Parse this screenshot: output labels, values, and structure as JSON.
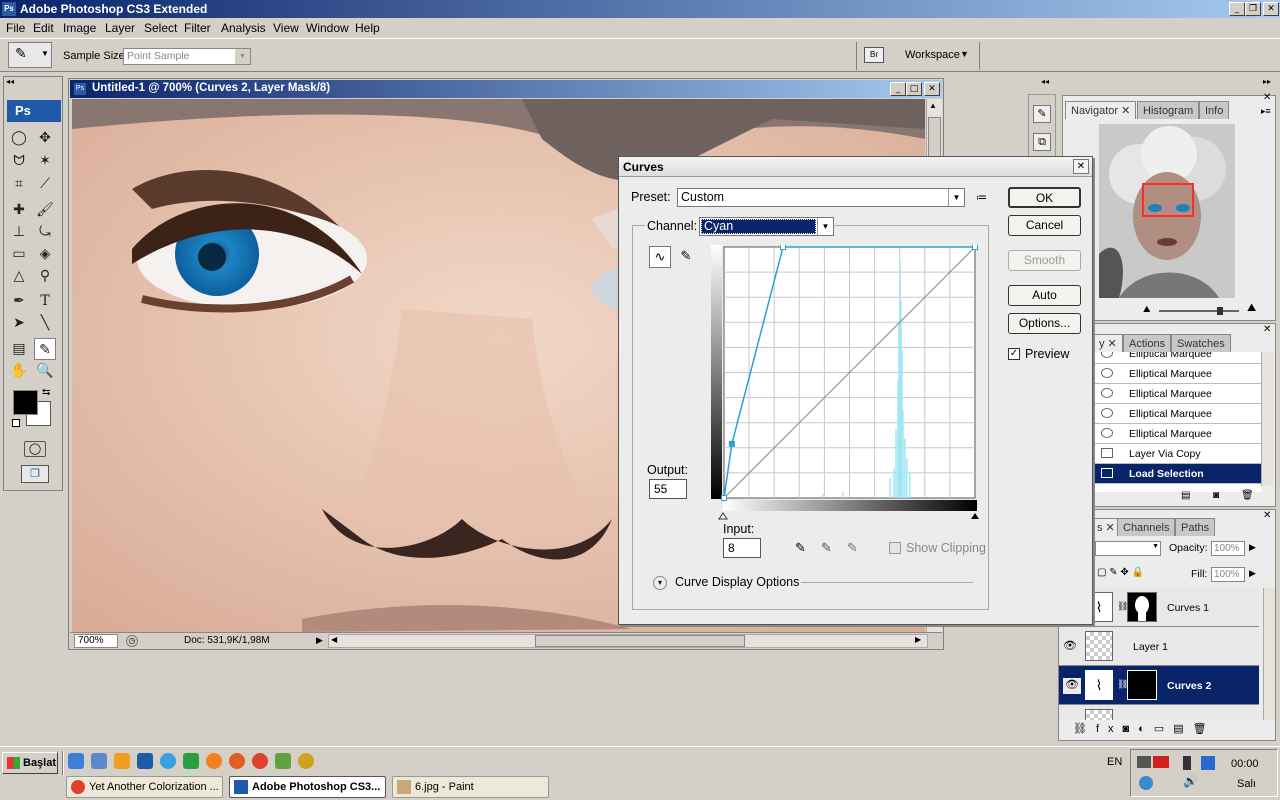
{
  "app": {
    "title": "Adobe Photoshop CS3 Extended",
    "ps_badge": "Ps"
  },
  "menu": [
    "File",
    "Edit",
    "Image",
    "Layer",
    "Select",
    "Filter",
    "Analysis",
    "View",
    "Window",
    "Help"
  ],
  "options_bar": {
    "sample_size_label": "Sample Size:",
    "sample_size_value": "Point Sample",
    "workspace_label": "Workspace"
  },
  "document": {
    "title": "Untitled-1 @ 700% (Curves 2, Layer Mask/8)",
    "zoom": "700%",
    "doc_info": "Doc: 531,9K/1,98M"
  },
  "navigator_panel": {
    "tabs": [
      "Navigator",
      "Histogram",
      "Info"
    ]
  },
  "history_panel": {
    "tabs": [
      "y",
      "Actions",
      "Swatches"
    ],
    "items": [
      "Elliptical Marquee",
      "Elliptical Marquee",
      "Elliptical Marquee",
      "Elliptical Marquee",
      "Elliptical Marquee",
      "Layer Via Copy",
      "Load Selection"
    ],
    "selected_index": 6
  },
  "layers_panel": {
    "tabs": [
      "s",
      "Channels",
      "Paths"
    ],
    "opacity_label": "Opacity:",
    "opacity_value": "100%",
    "fill_label": "Fill:",
    "fill_value": "100%",
    "layers": [
      "Curves 1",
      "Layer 1",
      "Curves 2"
    ],
    "selected_index": 2
  },
  "curves_dialog": {
    "title": "Curves",
    "preset_label": "Preset:",
    "preset_value": "Custom",
    "channel_label": "Channel:",
    "channel_value": "Cyan",
    "output_label": "Output:",
    "output_value": "55",
    "input_label": "Input:",
    "input_value": "8",
    "show_clipping_label": "Show Clipping",
    "curve_display_options_label": "Curve Display Options",
    "buttons": {
      "ok": "OK",
      "cancel": "Cancel",
      "smooth": "Smooth",
      "auto": "Auto",
      "options": "Options..."
    },
    "preview_label": "Preview",
    "preview_checked": true,
    "curve_points": [
      [
        0,
        0
      ],
      [
        8,
        55
      ],
      [
        60,
        255
      ],
      [
        255,
        255
      ]
    ]
  },
  "taskbar": {
    "start_label": "Başlat",
    "tasks": [
      "Yet Another Colorization ...",
      "Adobe Photoshop CS3...",
      "6.jpg - Paint"
    ],
    "active_task": 1,
    "language": "EN",
    "time": "00:00",
    "day": "Salı"
  },
  "colors": {
    "title_bar": "#0a246a",
    "selection": "#0a246a",
    "curve": "#29a3d6",
    "histogram": "#9ee6f2"
  }
}
